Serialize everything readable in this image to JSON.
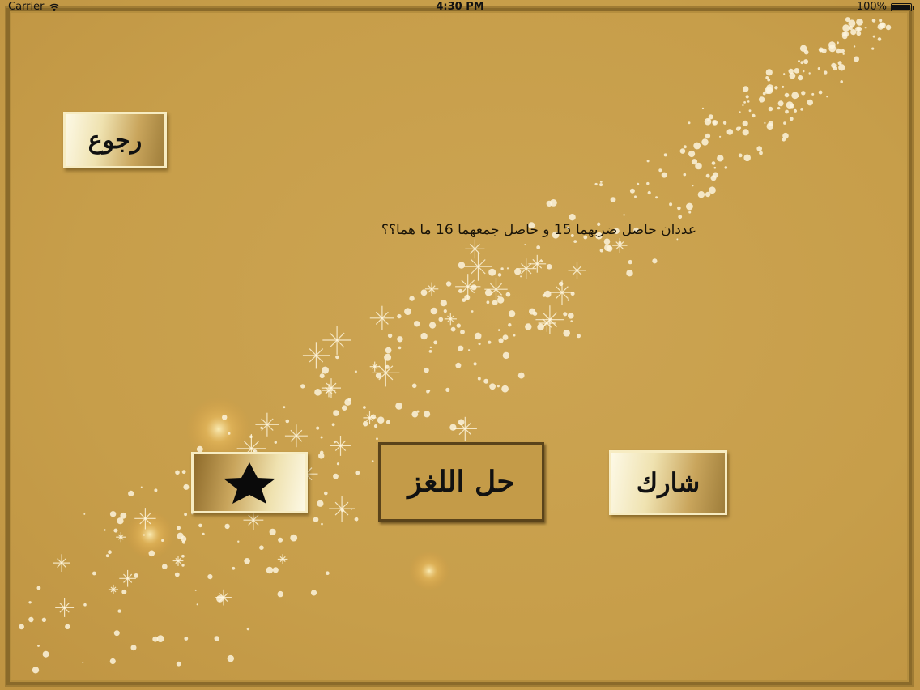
{
  "status_bar": {
    "carrier": "Carrier",
    "time": "4:30 PM",
    "battery": "100%",
    "wifi_icon": "wifi-icon",
    "battery_icon": "battery-icon"
  },
  "back_button": {
    "label": "رجوع"
  },
  "riddle": {
    "question": "عددان حاصل ضربهما 15 و حاصل جمعهما 16 ما هما؟؟"
  },
  "actions": {
    "favorite_icon": "star-icon",
    "solve_label": "حل اللغز",
    "share_label": "شارك"
  },
  "colors": {
    "background": "#c9a04c",
    "button_light": "#fdf9e6",
    "button_dark": "#9e7d3a",
    "text": "#111111"
  }
}
